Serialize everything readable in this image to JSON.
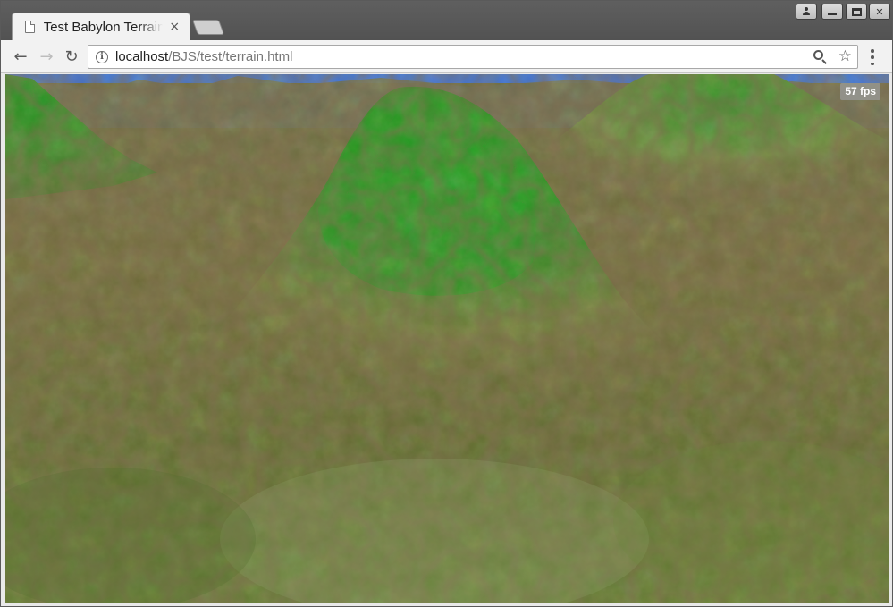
{
  "browser": {
    "tab": {
      "title": "Test Babylon Terrain",
      "close_glyph": "×",
      "icon": "page-icon"
    },
    "window_controls": [
      "user-icon",
      "minimize-icon",
      "maximize-icon",
      "close-icon"
    ],
    "address_bar": {
      "host": "localhost",
      "path": "/BJS/test/terrain.html",
      "info_glyph": "i"
    },
    "nav": {
      "back_glyph": "←",
      "forward_glyph": "→",
      "reload_glyph": "↻"
    },
    "star_glyph": "☆"
  },
  "scene": {
    "fps_label": "57 fps",
    "sky_color": "#3d71d6",
    "grass_color": "#1f8a1f",
    "soil_color": "#7a6a3a"
  }
}
